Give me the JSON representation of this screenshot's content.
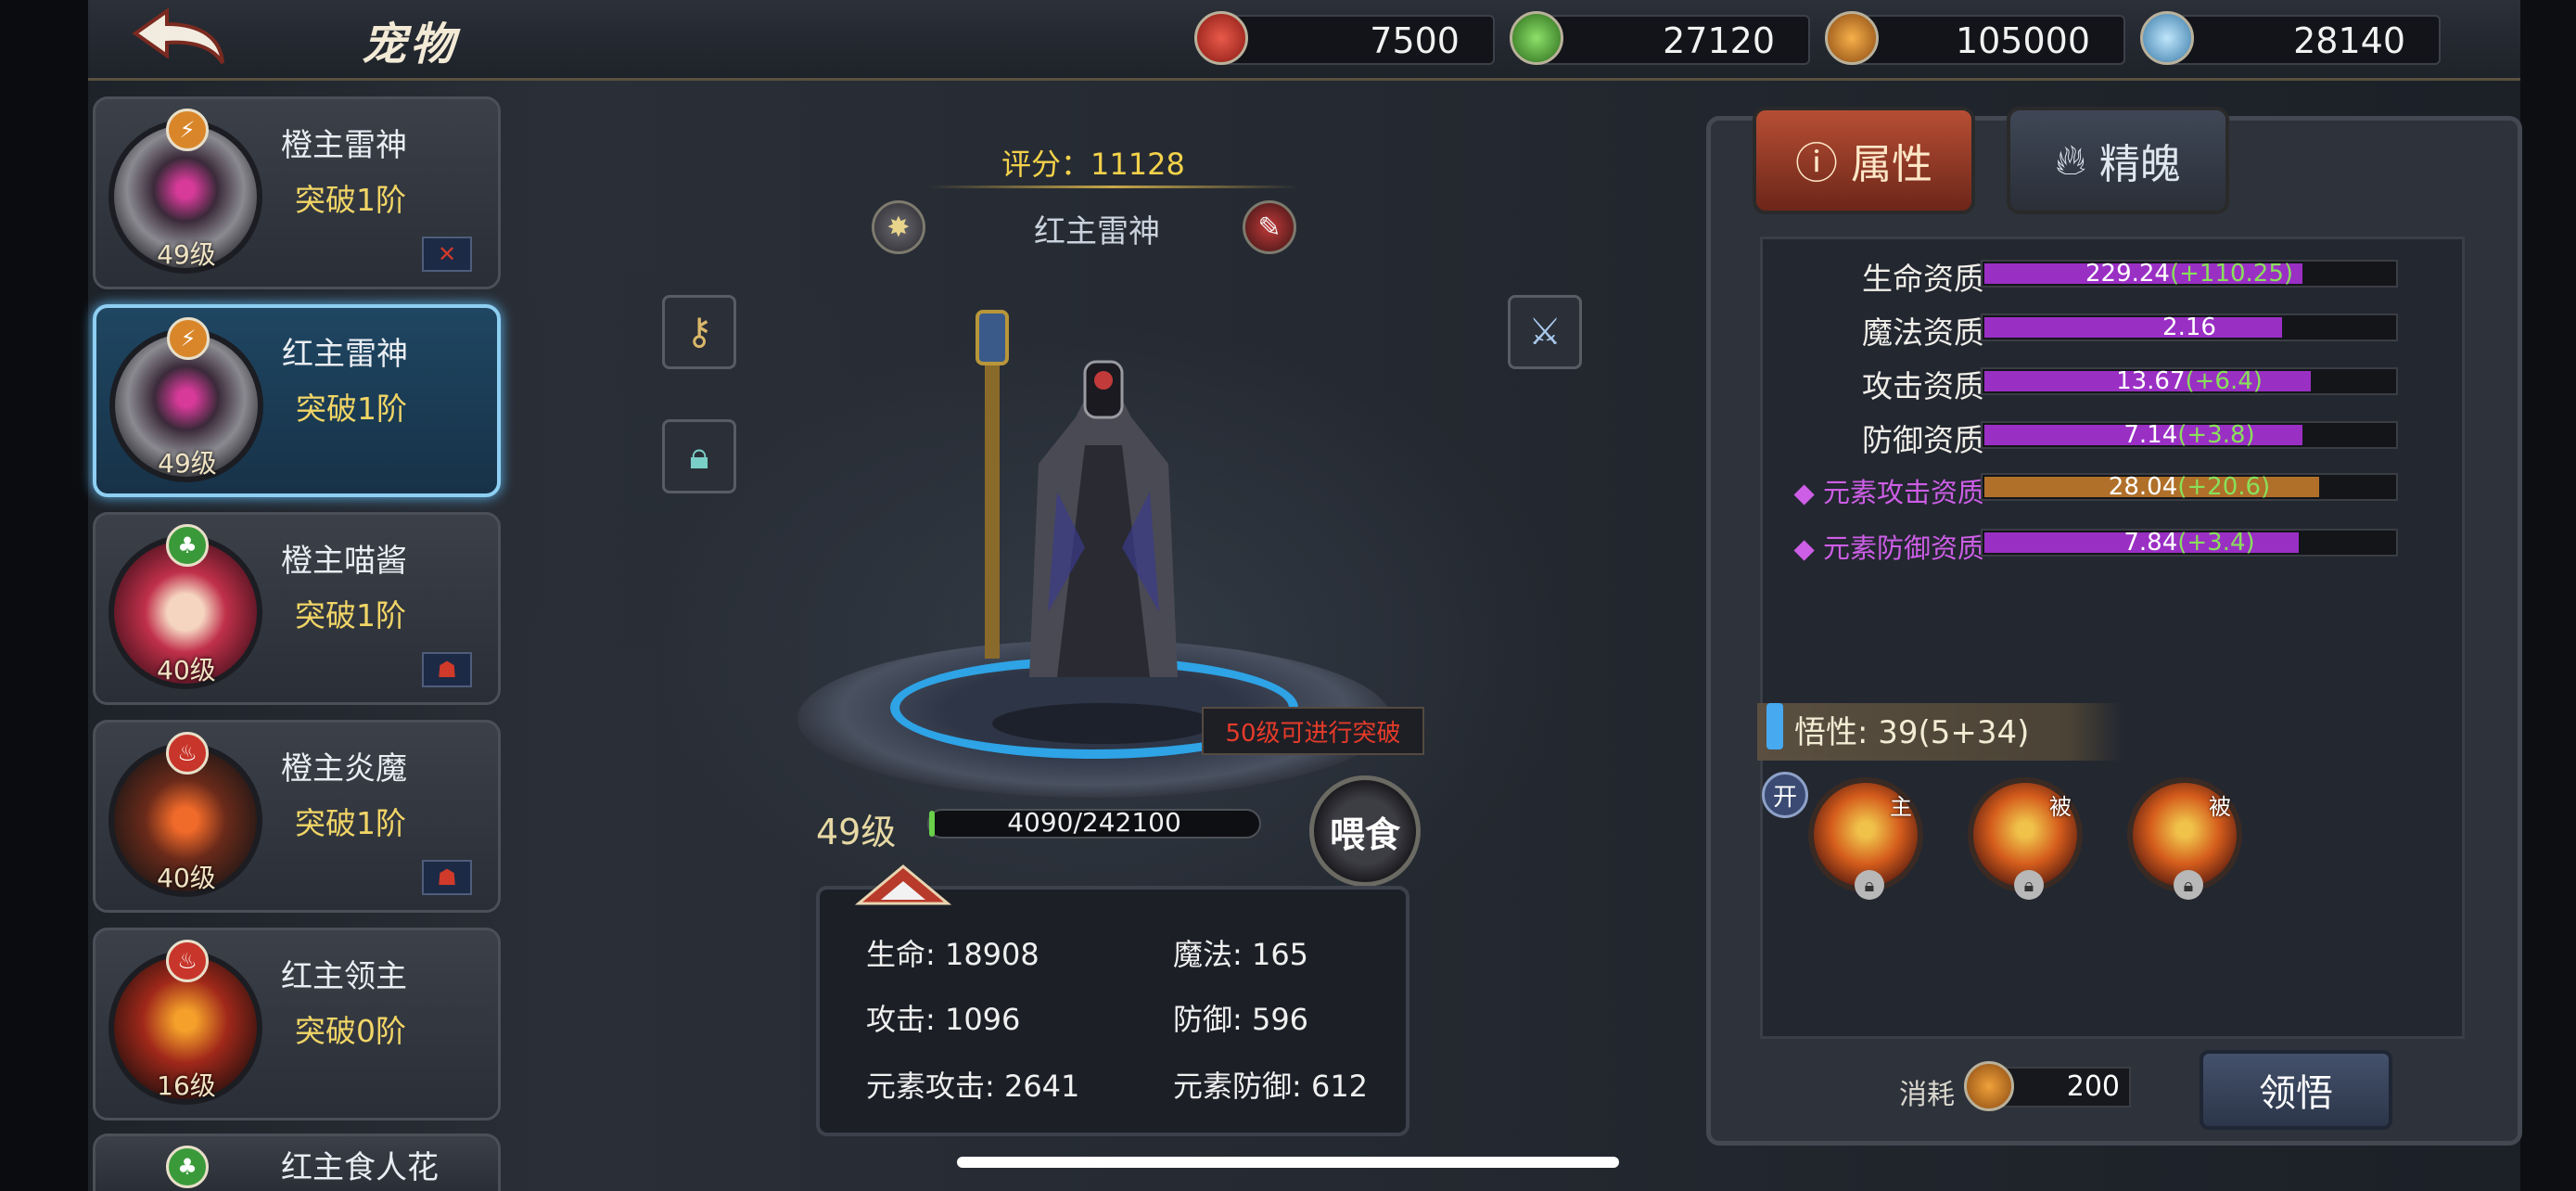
{
  "header": {
    "title": "宠物"
  },
  "resources": [
    {
      "icon": "red-crystal-icon",
      "value": "7500",
      "color": "#c8352a"
    },
    {
      "icon": "green-crystal-icon",
      "value": "27120",
      "color": "#4aa53a"
    },
    {
      "icon": "lightning-coin-icon",
      "value": "105000",
      "color": "#d98a2a"
    },
    {
      "icon": "ice-crystal-icon",
      "value": "28140",
      "color": "#5aa7d6"
    }
  ],
  "pets": [
    {
      "name": "橙主雷神",
      "stage": "突破1阶",
      "level": "49级",
      "element": "lightning",
      "selected": false
    },
    {
      "name": "红主雷神",
      "stage": "突破1阶",
      "level": "49级",
      "element": "lightning",
      "selected": true
    },
    {
      "name": "橙主喵酱",
      "stage": "突破1阶",
      "level": "40级",
      "element": "nature",
      "selected": false
    },
    {
      "name": "橙主炎魔",
      "stage": "突破1阶",
      "level": "40级",
      "element": "fire",
      "selected": false
    },
    {
      "name": "红主领主",
      "stage": "突破0阶",
      "level": "16级",
      "element": "fire",
      "selected": false
    },
    {
      "name": "红主食人花",
      "element": "nature"
    }
  ],
  "pet": {
    "score": "评分：11128",
    "name": "红主雷神",
    "tip": "50级可进行突破",
    "level": "49级",
    "xp": "4090/242100",
    "xp_progress": 0.017,
    "feed_label": "喂食",
    "stats": {
      "hp": "生命: 18908",
      "mp": "魔法: 165",
      "atk": "攻击: 1096",
      "def": "防御: 596",
      "eatk": "元素攻击: 2641",
      "edef": "元素防御: 612"
    }
  },
  "tabs": {
    "attr": "属性",
    "soul": "精魄"
  },
  "aptitudes": [
    {
      "label": "生命资质",
      "base": "229.24",
      "bonus": "(+110.25)",
      "fill": 0.77,
      "color": "#9a2fc4",
      "elemental": false
    },
    {
      "label": "魔法资质",
      "base": "2.16",
      "bonus": "",
      "fill": 0.72,
      "color": "#9a2fc4",
      "elemental": false
    },
    {
      "label": "攻击资质",
      "base": "13.67",
      "bonus": "(+6.4)",
      "fill": 0.79,
      "color": "#9a2fc4",
      "elemental": false
    },
    {
      "label": "防御资质",
      "base": "7.14",
      "bonus": "(+3.8)",
      "fill": 0.77,
      "color": "#9a2fc4",
      "elemental": false
    },
    {
      "label": "元素攻击资质",
      "base": "28.04",
      "bonus": "(+20.6)",
      "fill": 0.81,
      "color": "#b0702a",
      "elemental": true
    },
    {
      "label": "元素防御资质",
      "base": "7.84",
      "bonus": "(+3.4)",
      "fill": 0.76,
      "color": "#9a2fc4",
      "elemental": true
    }
  ],
  "wisdom": {
    "label": "悟性: 39(5+34)",
    "open": "开"
  },
  "skills": [
    {
      "tag": "主",
      "icon": "lightning-skill-icon"
    },
    {
      "tag": "被",
      "icon": "lightning-skill-icon"
    },
    {
      "tag": "被",
      "icon": "lightning-skill-icon"
    }
  ],
  "cost": {
    "label": "消耗",
    "value": "200"
  },
  "enlighten_label": "领悟"
}
